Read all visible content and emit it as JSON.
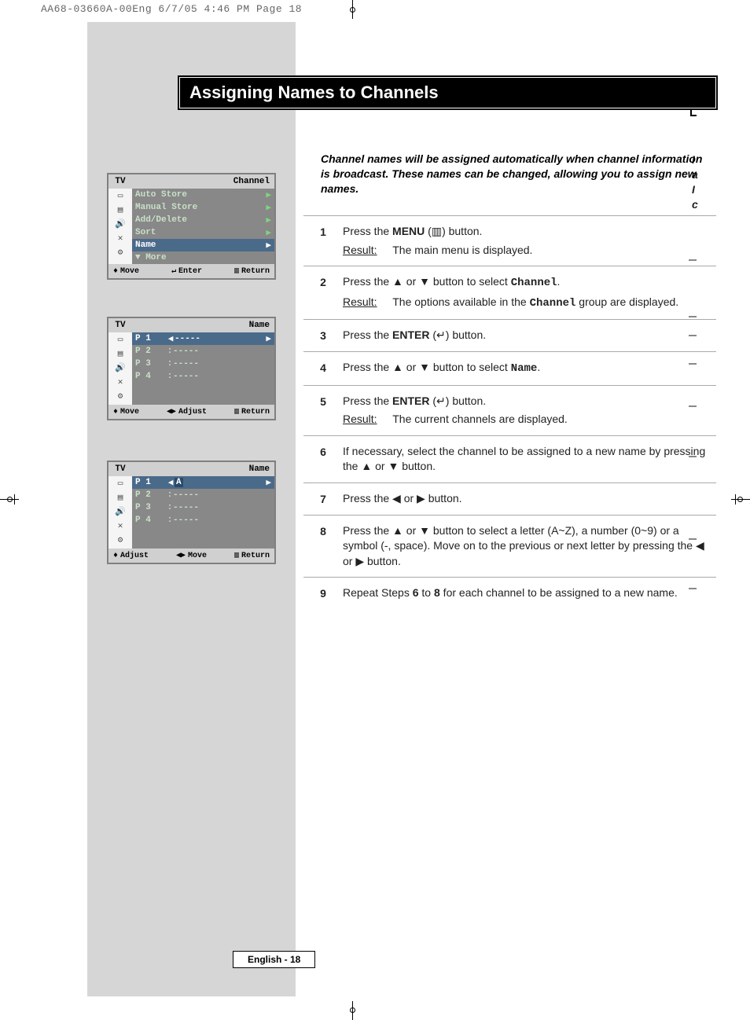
{
  "header": "AA68-03660A-00Eng  6/7/05  4:46 PM  Page 18",
  "title": "Assigning Names to Channels",
  "intro": "Channel names will be assigned automatically when channel information is broadcast. These names can be changed, allowing you to assign new names.",
  "page_label": "English - 18",
  "right_edge": {
    "l1": "I",
    "l2": "a",
    "l3": "I",
    "l4": "c"
  },
  "osd1": {
    "left_hdr": "TV",
    "right_hdr": "Channel",
    "rows": [
      {
        "label": "Auto Store"
      },
      {
        "label": "Manual Store"
      },
      {
        "label": "Add/Delete"
      },
      {
        "label": "Sort"
      },
      {
        "label": "Name",
        "sel": true
      },
      {
        "label": "▼ More"
      }
    ],
    "foot_l": "Move",
    "foot_m": "Enter",
    "foot_r": "Return"
  },
  "osd2": {
    "left_hdr": "TV",
    "right_hdr": "Name",
    "rows": [
      {
        "p": "P 1",
        "sep": "",
        "val": "-----",
        "sel": true,
        "arrows": true
      },
      {
        "p": "P 2",
        "sep": ":",
        "val": "-----"
      },
      {
        "p": "P 3",
        "sep": ":",
        "val": "-----"
      },
      {
        "p": "P 4",
        "sep": ":",
        "val": "-----"
      }
    ],
    "foot_l": "Move",
    "foot_m": "Adjust",
    "foot_r": "Return"
  },
  "osd3": {
    "left_hdr": "TV",
    "right_hdr": "Name",
    "rows": [
      {
        "p": "P 1",
        "sep": "",
        "val": "A",
        "sel": true,
        "arrows": true,
        "hl": true
      },
      {
        "p": "P 2",
        "sep": ":",
        "val": "-----"
      },
      {
        "p": "P 3",
        "sep": ":",
        "val": "-----"
      },
      {
        "p": "P 4",
        "sep": ":",
        "val": "-----"
      }
    ],
    "foot_l": "Adjust",
    "foot_m": "Move",
    "foot_r": "Return"
  },
  "steps": {
    "s1a": "Press the ",
    "s1b": "MENU",
    "s1c": " (",
    "s1d": ") button.",
    "s1r": "Result:",
    "s1rt": "The main menu is displayed.",
    "s2a": "Press the ",
    "s2b": " or ",
    "s2c": " button to select ",
    "s2d": "Channel",
    "s2e": ".",
    "s2r": "Result:",
    "s2rt1": "The options available in the ",
    "s2rt2": "Channel",
    "s2rt3": " group are displayed.",
    "s3a": "Press the ",
    "s3b": "ENTER",
    "s3c": " (",
    "s3d": ") button.",
    "s4a": "Press the ",
    "s4b": " or ",
    "s4c": " button to select ",
    "s4d": "Name",
    "s4e": ".",
    "s5a": "Press the ",
    "s5b": "ENTER",
    "s5c": " (",
    "s5d": ") button.",
    "s5r": "Result:",
    "s5rt": "The current channels are displayed.",
    "s6a": "If necessary, select the channel to be assigned to a new name by pressing the ",
    "s6b": " or ",
    "s6c": " button.",
    "s7a": "Press the ",
    "s7b": " or ",
    "s7c": " button.",
    "s8a": "Press the ",
    "s8b": " or ",
    "s8c": " button to select a letter (A~Z), a number (0~9) or a symbol (-, space). Move on to the previous or next letter by pressing the ",
    "s8d": " or ",
    "s8e": " button.",
    "s9a": "Repeat Steps ",
    "s9b": "6",
    "s9c": " to ",
    "s9d": "8",
    "s9e": " for each channel to be assigned to a new name."
  },
  "sym": {
    "up": "▲",
    "down": "▼",
    "left": "◀",
    "right": "▶",
    "ud": "◆",
    "lr": "◀▶",
    "menu": "▥",
    "enter": "↵"
  }
}
